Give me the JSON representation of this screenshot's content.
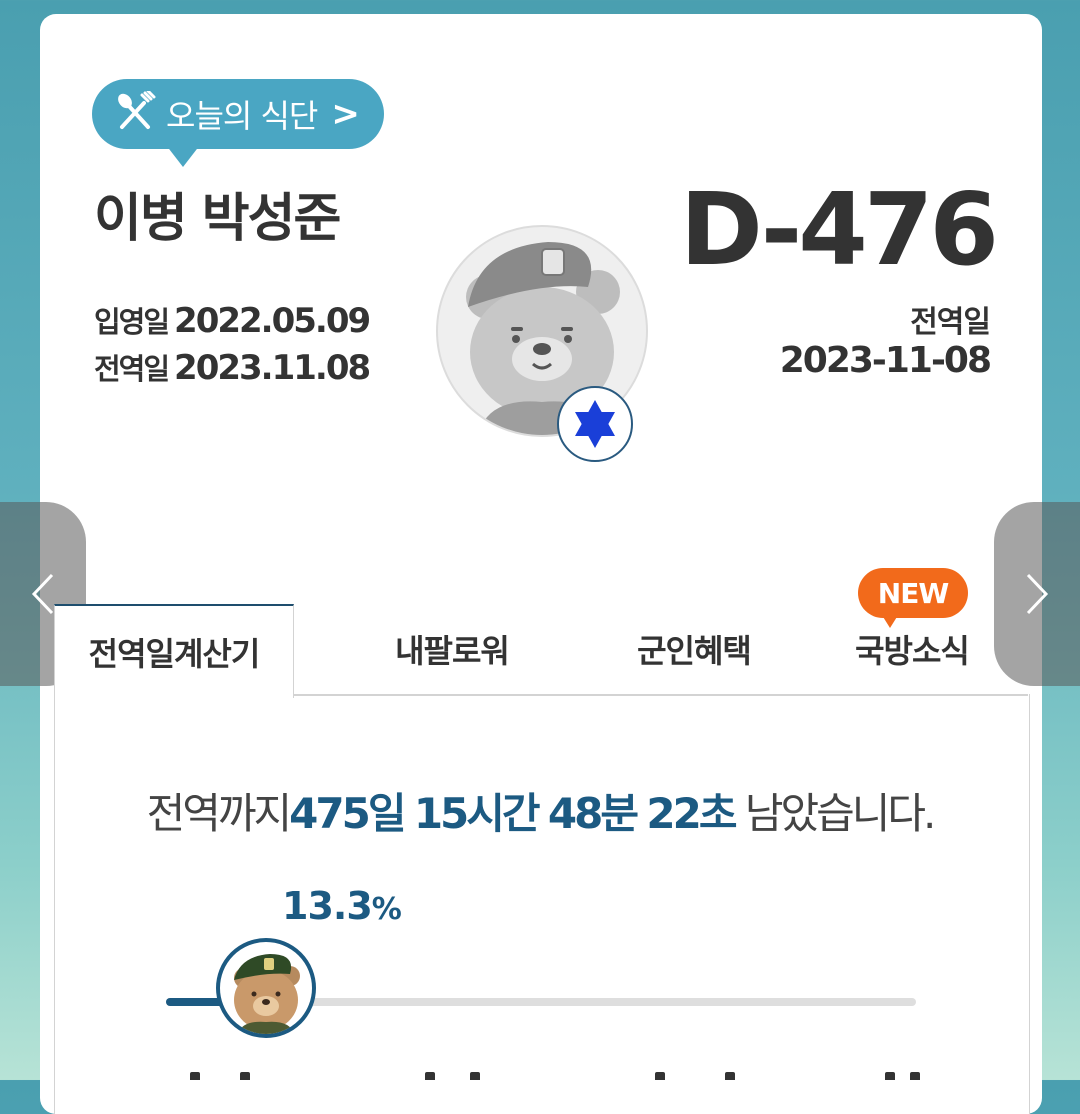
{
  "meal": {
    "label": "오늘의 식단",
    "chevron": ">"
  },
  "profile": {
    "name": "이병 박성준",
    "enlist_label": "입영일",
    "enlist_date": "2022.05.09",
    "discharge_label": "전역일",
    "discharge_date": "2023.11.08"
  },
  "dday": {
    "value": "D-476",
    "label": "전역일",
    "date": "2023-11-08"
  },
  "tabs": [
    {
      "label": "전역일계산기",
      "active": true
    },
    {
      "label": "내팔로워",
      "active": false
    },
    {
      "label": "군인혜택",
      "active": false
    },
    {
      "label": "국방소식",
      "active": false
    }
  ],
  "new_badge": "NEW",
  "countdown": {
    "prefix": "전역까지",
    "days": "475일",
    "hours": "15시간",
    "minutes": "48분",
    "seconds": "22초",
    "suffix": "남았습니다."
  },
  "progress": {
    "value": "13.3",
    "unit": "%",
    "fraction": 0.133
  },
  "colors": {
    "accent": "#1c5a82",
    "meal": "#4aa6c3",
    "new": "#f26a1b"
  },
  "icons": [
    "fork-knife-icon",
    "chevron-right-icon",
    "chevron-left-icon",
    "star-of-david-icon",
    "bear-avatar-icon"
  ]
}
